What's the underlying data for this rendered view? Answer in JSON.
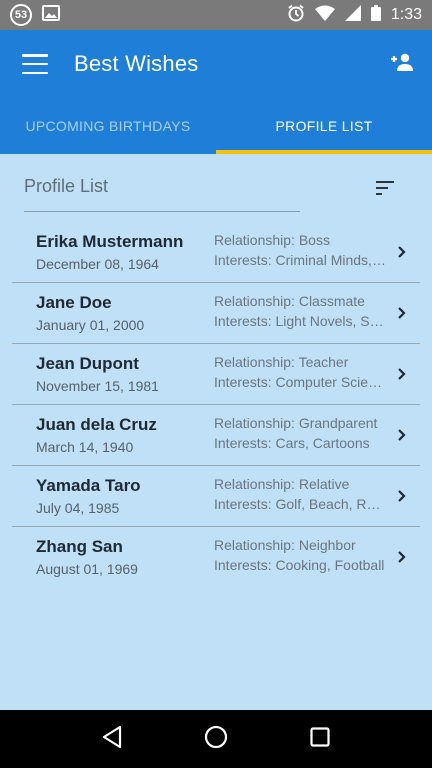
{
  "status_bar": {
    "notification_count": "53",
    "time": "1:33"
  },
  "app_bar": {
    "title": "Best Wishes"
  },
  "tabs": [
    {
      "label": "UPCOMING BIRTHDAYS",
      "active": false
    },
    {
      "label": "PROFILE LIST",
      "active": true
    }
  ],
  "list_header": {
    "title": "Profile List"
  },
  "profiles": [
    {
      "name": "Erika Mustermann",
      "date": "December 08, 1964",
      "relationship": "Relationship: Boss",
      "interests": "Interests: Criminal Minds, Chess"
    },
    {
      "name": "Jane Doe",
      "date": "January 01, 2000",
      "relationship": "Relationship: Classmate",
      "interests": "Interests: Light Novels, Sushi"
    },
    {
      "name": "Jean Dupont",
      "date": "November 15, 1981",
      "relationship": "Relationship: Teacher",
      "interests": "Interests: Computer Science"
    },
    {
      "name": "Juan dela Cruz",
      "date": "March 14, 1940",
      "relationship": "Relationship: Grandparent",
      "interests": "Interests: Cars, Cartoons"
    },
    {
      "name": "Yamada Taro",
      "date": "July 04, 1985",
      "relationship": "Relationship: Relative",
      "interests": "Interests: Golf, Beach, Reading"
    },
    {
      "name": "Zhang San",
      "date": "August 01, 1969",
      "relationship": "Relationship: Neighbor",
      "interests": "Interests: Cooking, Football"
    }
  ],
  "colors": {
    "primary": "#1f7fd8",
    "tab_indicator": "#f4c20d",
    "background": "#bfe0f7"
  }
}
